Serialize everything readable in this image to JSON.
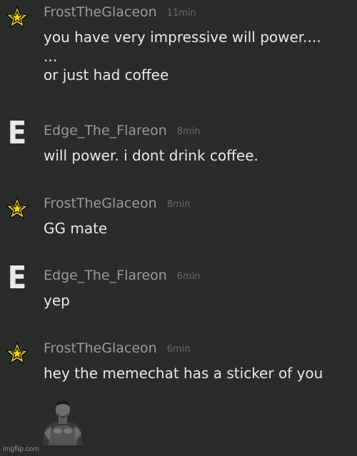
{
  "messages": [
    {
      "avatar": "star-icon",
      "username": "FrostTheGlaceon",
      "timestamp": "11min",
      "text": "you have very impressive will power....\n...\nor just had coffee"
    },
    {
      "avatar": "letter-e",
      "avatar_letter": "E",
      "username": "Edge_The_Flareon",
      "timestamp": "8min",
      "text": "will power. i dont drink coffee."
    },
    {
      "avatar": "star-icon",
      "username": "FrostTheGlaceon",
      "timestamp": "8min",
      "text": "GG mate"
    },
    {
      "avatar": "letter-e",
      "avatar_letter": "E",
      "username": "Edge_The_Flareon",
      "timestamp": "6min",
      "text": "yep"
    },
    {
      "avatar": "star-icon",
      "username": "FrostTheGlaceon",
      "timestamp": "6min",
      "text": "hey the memechat has a sticker of you"
    }
  ],
  "sticker": {
    "icon": "meme-sticker-image"
  },
  "watermark": "imgflip.com",
  "colors": {
    "background": "#2b2b2b",
    "username": "#9a9a9a",
    "timestamp": "#6a6a6a",
    "text": "#e8e8e8",
    "star_fill": "#e9d21b",
    "star_outline": "#111111"
  }
}
